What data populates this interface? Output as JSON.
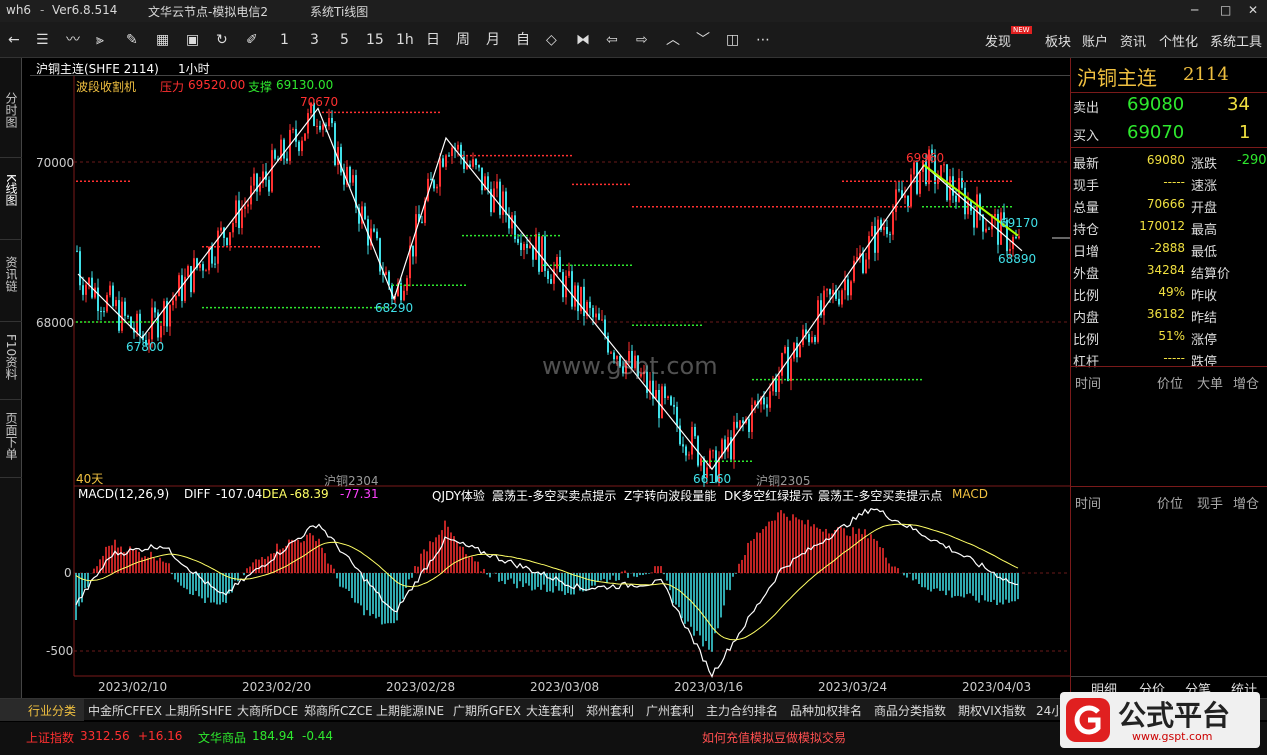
{
  "titlebar": {
    "app": "wh6",
    "version": "Ver6.8.514",
    "server": "文华云节点-模拟电信2",
    "menu": "系统Ti线图"
  },
  "toolbar": {
    "periods": [
      "1",
      "3",
      "5",
      "15",
      "1h",
      "日",
      "周",
      "月",
      "自"
    ],
    "right_menu": [
      "发现",
      "板块",
      "账户",
      "资讯",
      "个性化",
      "系统工具"
    ],
    "new_badge": "NEW"
  },
  "leftbar": {
    "tabs": [
      "分时图",
      "K线图",
      "资讯链",
      "F10资料",
      "页面下单"
    ]
  },
  "chart_header": {
    "symbol": "沪铜主连(SHFE 2114)",
    "period": "1小时",
    "indicator": "波段收割机",
    "pressure_label": "压力",
    "pressure": "69520.00",
    "support_label": "支撑",
    "support": "69130.00"
  },
  "price_axis": {
    "labels": [
      "70000",
      "68000"
    ]
  },
  "annotations": {
    "h1": "70670",
    "h2": "69960",
    "l1": "67800",
    "l2": "68290",
    "l3": "66160",
    "r1": "69170",
    "r2": "68890",
    "days": "40天",
    "contract1": "沪铜2304",
    "contract2": "沪铜2305"
  },
  "watermark": "www.gspt.com",
  "macd": {
    "title": "MACD(12,26,9)",
    "diff_label": "DIFF",
    "diff": "-107.04",
    "dea_label": "DEA",
    "dea": "-68.39",
    "macd_val": "-77.31",
    "tools": [
      "QJDY体验",
      "震荡王-多空买卖点提示",
      "Z字转向波段量能",
      "DK多空红绿提示",
      "震荡王-多空买卖提示点",
      "MACD"
    ],
    "axis": [
      "0",
      "-500"
    ]
  },
  "dates": [
    "2023/02/10",
    "2023/02/20",
    "2023/02/28",
    "2023/03/08",
    "2023/03/16",
    "2023/03/24",
    "2023/04/03"
  ],
  "quote": {
    "name": "沪铜主连",
    "code": "2114",
    "sell_label": "卖出",
    "sell_price": "69080",
    "sell_vol": "34",
    "buy_label": "买入",
    "buy_price": "69070",
    "buy_vol": "1",
    "rows": [
      [
        "最新",
        "69080",
        "涨跌",
        "-290"
      ],
      [
        "现手",
        "-----",
        "速涨",
        ""
      ],
      [
        "总量",
        "70666",
        "开盘",
        ""
      ],
      [
        "持仓",
        "170012",
        "最高",
        ""
      ],
      [
        "日增",
        "-2888",
        "最低",
        ""
      ],
      [
        "外盘",
        "34284",
        "结算价",
        ""
      ],
      [
        "比例",
        "49%",
        "昨收",
        ""
      ],
      [
        "内盘",
        "36182",
        "昨结",
        ""
      ],
      [
        "比例",
        "51%",
        "涨停",
        ""
      ],
      [
        "杠杆",
        "-----",
        "跌停",
        ""
      ]
    ]
  },
  "ticks_header": [
    "时间",
    "价位",
    "大单",
    "增仓"
  ],
  "ticks_header2": [
    "时间",
    "价位",
    "现手",
    "增仓"
  ],
  "right_tabs": [
    "明细",
    "分价",
    "分笔",
    "统计"
  ],
  "bottom_tabs": [
    "行业分类",
    "中金所CFFEX",
    "上期所SHFE",
    "大商所DCE",
    "郑商所CZCE",
    "上期能源INE",
    "广期所GFEX",
    "大连套利",
    "郑州套利",
    "广州套利",
    "主力合约排名",
    "品种加权排名",
    "商品分类指数",
    "期权VIX指数",
    "24小"
  ],
  "status": {
    "idx1_name": "上证指数",
    "idx1_val": "3312.56",
    "idx1_chg": "+16.16",
    "idx2_name": "文华商品",
    "idx2_val": "184.94",
    "idx2_chg": "-0.44",
    "notice": "如何充值模拟豆做模拟交易"
  },
  "logo": {
    "text": "公式平台",
    "url": "www.gspt.com"
  },
  "colors": {
    "up": "#ff3030",
    "down": "#40e0e8",
    "support": "#2ee82e",
    "pressure": "#ff3030",
    "zigzag": "#ffffff"
  }
}
